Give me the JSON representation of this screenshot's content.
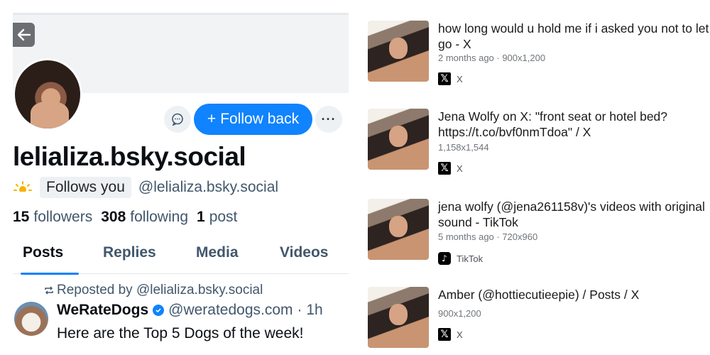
{
  "profile": {
    "display_name": "lelializa.bsky.social",
    "follows_you": "Follows you",
    "handle": "@lelializa.bsky.social",
    "follow_button": "Follow back",
    "stats": {
      "followers_count": "15",
      "followers_label": "followers",
      "following_count": "308",
      "following_label": "following",
      "posts_count": "1",
      "posts_label": "post"
    },
    "tabs": [
      "Posts",
      "Replies",
      "Media",
      "Videos"
    ],
    "active_tab": "Posts",
    "accent_color": "#1083fe"
  },
  "post": {
    "repost_label": "Reposted by @lelializa.bsky.social",
    "author_name": "WeRateDogs",
    "author_handle": "@weratedogs.com",
    "time": "· 1h",
    "text": "Here are the Top 5 Dogs of the week!"
  },
  "results": [
    {
      "title": "how long would u hold me if i asked you not to let go - X",
      "meta": "2 months ago · 900x1,200",
      "source": "X",
      "icon": "x-logo-icon"
    },
    {
      "title": "Jena Wolfy on X: \"front seat or hotel bed? https://t.co/bvf0nmTdoa\" / X",
      "meta": "1,158x1,544",
      "source": "X",
      "icon": "x-logo-icon"
    },
    {
      "title": "jena wolfy (@jena261158v)'s videos with original sound - TikTok",
      "meta": "5 months ago · 720x960",
      "source": "TikTok",
      "icon": "tiktok-logo-icon"
    },
    {
      "title": "Amber (@hottiecutieepie) / Posts / X",
      "meta": "900x1,200",
      "source": "X",
      "icon": "x-logo-icon"
    }
  ],
  "icons": {
    "x": "𝕏",
    "tiktok": "♪"
  }
}
